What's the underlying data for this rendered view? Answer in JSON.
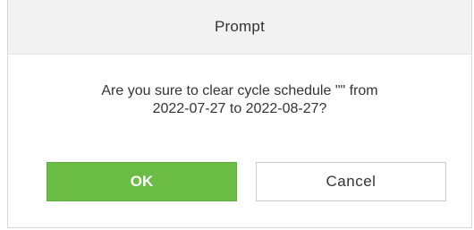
{
  "dialog": {
    "title": "Prompt",
    "message_line1": "Are you sure to clear cycle schedule \"\" from",
    "message_line2": "2022-07-27 to 2022-08-27?",
    "ok_label": "OK",
    "cancel_label": "Cancel"
  },
  "colors": {
    "ok_background": "#6abc45",
    "header_background": "#f2f2f2"
  }
}
